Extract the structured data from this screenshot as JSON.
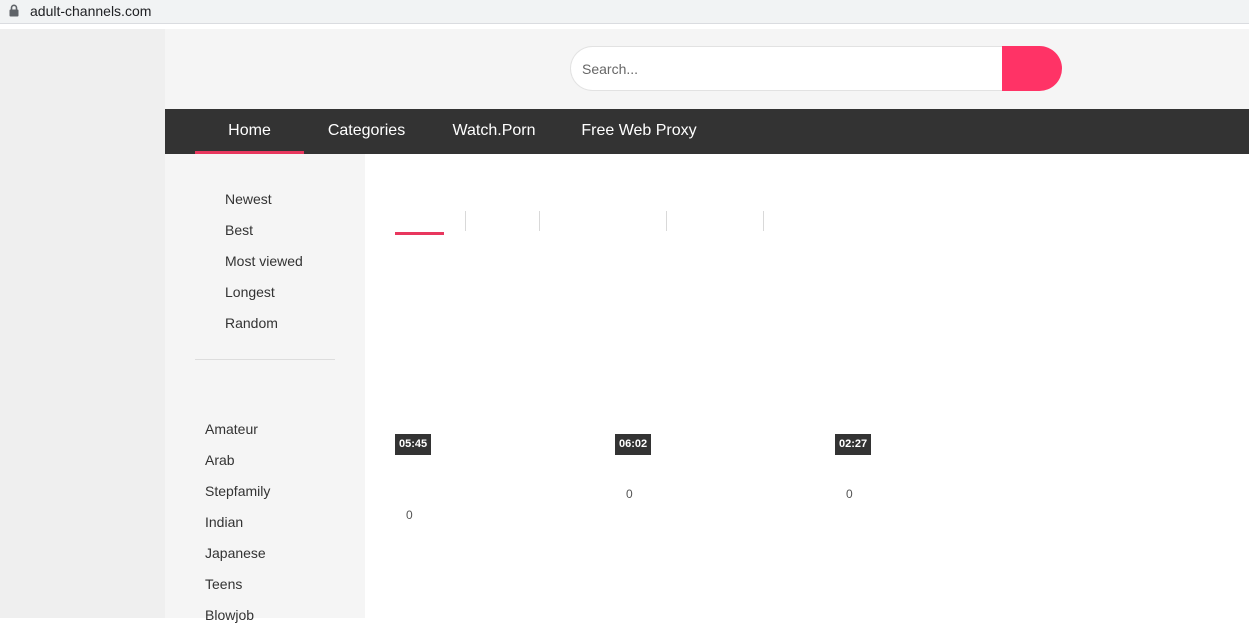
{
  "browser": {
    "url": "adult-channels.com"
  },
  "search": {
    "placeholder": "Search..."
  },
  "nav": {
    "items": [
      "Home",
      "Categories",
      "Watch.Porn",
      "Free Web Proxy"
    ],
    "active": "Home"
  },
  "sidebar": {
    "sort_links": [
      "Newest",
      "Best",
      "Most viewed",
      "Longest",
      "Random"
    ],
    "categories": [
      "Amateur",
      "Arab",
      "Stepfamily",
      "Indian",
      "Japanese",
      "Teens",
      "Blowjob"
    ]
  },
  "videos": [
    {
      "duration": "05:45",
      "views": "0"
    },
    {
      "duration": "06:02",
      "views": "0"
    },
    {
      "duration": "02:27",
      "views": "0"
    }
  ],
  "colors": {
    "accent": "#ff3366",
    "nav_bg": "#333333",
    "active_underline": "#e8375e"
  },
  "icons": {
    "lock": "lock-icon",
    "search": "search-icon"
  }
}
